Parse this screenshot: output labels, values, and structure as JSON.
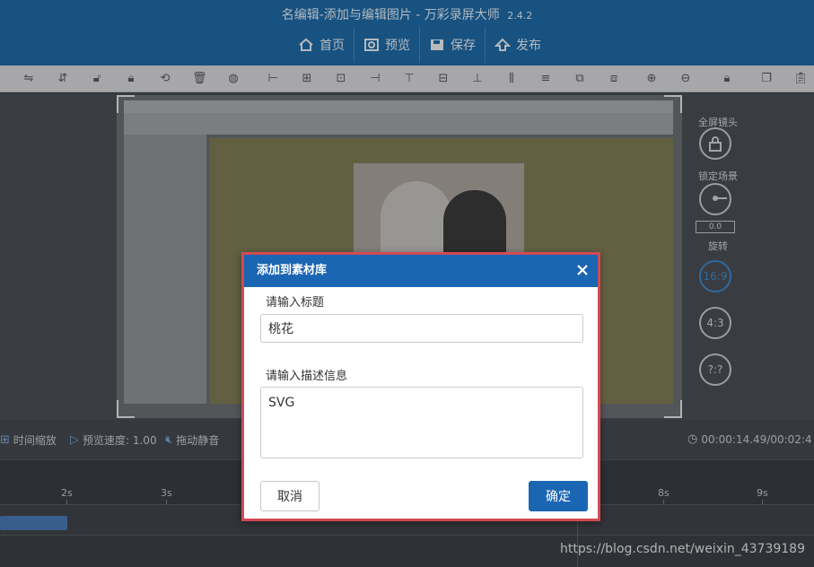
{
  "window": {
    "title": "名编辑-添加与编辑图片 - 万彩录屏大师",
    "version": "2.4.2"
  },
  "menu": [
    {
      "label": "首页",
      "icon": "home-icon"
    },
    {
      "label": "预览",
      "icon": "preview-icon"
    },
    {
      "label": "保存",
      "icon": "save-icon"
    },
    {
      "label": "发布",
      "icon": "publish-icon"
    }
  ],
  "right_tools": {
    "fullscreen_label": "全屏镜头",
    "lock_label": "锁定场景",
    "rotate_value": "0.0",
    "rotate_label": "旋转",
    "ratio_16_9": "16:9",
    "ratio_4_3": "4:3",
    "ratio_custom": "?:?"
  },
  "bottom_bar": {
    "time_zoom": "时间缩放",
    "preview_speed": "预览速度: 1.00",
    "auto_mute": "拖动静音",
    "time_display": "00:00:14.49/00:02:4"
  },
  "ruler": {
    "labels": [
      "2s",
      "3s",
      "8s",
      "9s"
    ]
  },
  "watermark": "https://blog.csdn.net/weixin_43739189",
  "dialog": {
    "title": "添加到素材库",
    "title_label": "请输入标题",
    "title_value": "桃花",
    "desc_label": "请输入描述信息",
    "desc_value": "SVG",
    "cancel_label": "取消",
    "ok_label": "确定"
  },
  "colors": {
    "header": "#1e6aa6",
    "accent": "#1b66b3",
    "dialog_border": "#d24a55",
    "playhead": "#d22d2d"
  }
}
